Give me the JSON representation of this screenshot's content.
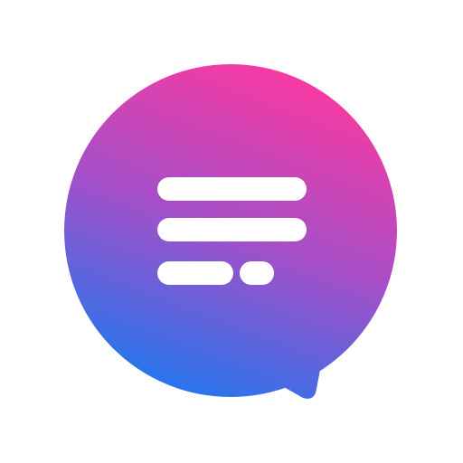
{
  "icon": {
    "name": "chat-bubble-icon",
    "colors": {
      "background": "#ffffff",
      "gradient_top": "#f53aa3",
      "gradient_mid": "#a44fc8",
      "gradient_bottom": "#2a74ec",
      "lines": "#ffffff"
    }
  }
}
